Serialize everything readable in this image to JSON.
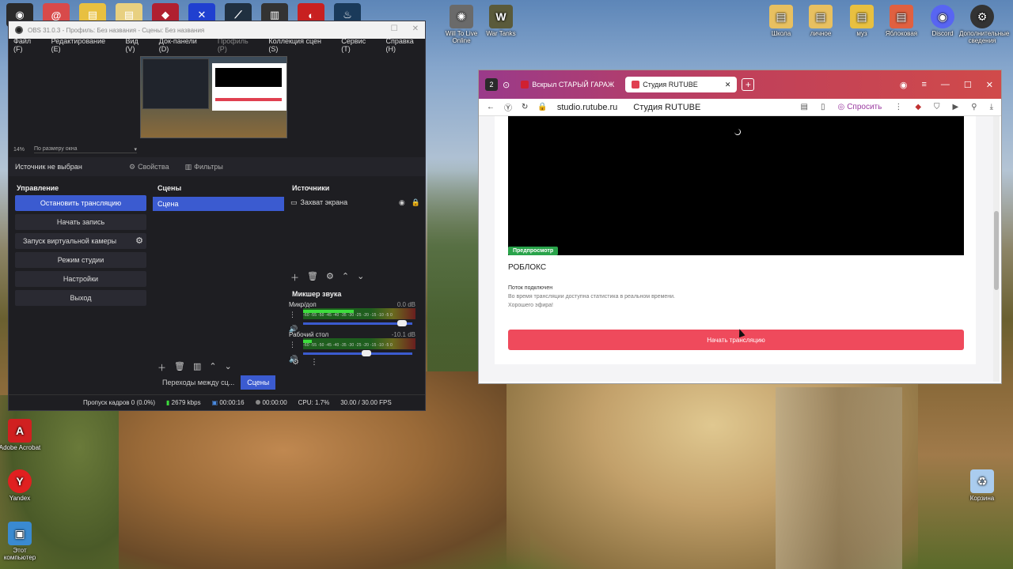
{
  "desktop": {
    "top_icons": [
      {
        "label": "",
        "color": "#2a2a2a",
        "icon": "camera-icon"
      },
      {
        "label": "",
        "color": "#d84a4a",
        "icon": "spiral-icon"
      },
      {
        "label": "",
        "color": "#e8c040",
        "icon": "folder-icon"
      },
      {
        "label": "",
        "color": "#e8d080",
        "icon": "folder-icon"
      },
      {
        "label": "",
        "color": "#b02030",
        "icon": "game-icon"
      },
      {
        "label": "",
        "color": "#2040d0",
        "icon": "playstation-icon"
      },
      {
        "label": "",
        "color": "#203040",
        "icon": "game-icon"
      },
      {
        "label": "",
        "color": "#333333",
        "icon": "armor-icon"
      },
      {
        "label": "",
        "color": "#c82020",
        "icon": "circle-icon"
      },
      {
        "label": "",
        "color": "#1a3a5a",
        "icon": "steam-icon"
      }
    ],
    "icons": [
      {
        "label": "Will To Live Online",
        "symbol": "✺",
        "color": "#6a6a6a"
      },
      {
        "label": "War Tanks",
        "symbol": "W",
        "color": "#5a5a3a"
      },
      {
        "label": "Школа",
        "symbol": "▤",
        "color": "#e8c060"
      },
      {
        "label": "личное",
        "symbol": "▤",
        "color": "#e8c060"
      },
      {
        "label": "муз",
        "symbol": "▤",
        "color": "#e8c040"
      },
      {
        "label": "Яблоковая",
        "symbol": "▤",
        "color": "#e06040"
      },
      {
        "label": "Discord",
        "symbol": "◉",
        "color": "#5865f2"
      },
      {
        "label": "Дополнительные сведения",
        "symbol": "⚙",
        "color": "#333333"
      },
      {
        "label": "Adobe Acrobat",
        "symbol": "A",
        "color": "#d02020"
      },
      {
        "label": "Yandex",
        "symbol": "Y",
        "color": "#e02020"
      },
      {
        "label": "Этот компьютер",
        "symbol": "▣",
        "color": "#3a8ad0"
      },
      {
        "label": "Корзина",
        "symbol": "♻",
        "color": "#aaccee"
      }
    ]
  },
  "obs": {
    "title": "OBS 31.0.3 - Профиль: Без названия - Сцены: Без названия",
    "menu": [
      "Файл (F)",
      "Редактирование (E)",
      "Вид (V)",
      "Док-панели (D)",
      "Профиль (P)",
      "Коллекция сцен (S)",
      "Сервис (T)",
      "Справка (H)"
    ],
    "zoom": {
      "percent": "14%",
      "mode": "По размеру окна"
    },
    "source_bar": {
      "no_source": "Источник не выбран",
      "properties": "Свойства",
      "filters": "Фильтры"
    },
    "controls": {
      "title": "Управление",
      "stop_stream": "Остановить трансляцию",
      "start_record": "Начать запись",
      "virtual_cam": "Запуск виртуальной камеры",
      "studio_mode": "Режим студии",
      "settings": "Настройки",
      "exit": "Выход"
    },
    "scenes": {
      "title": "Сцены",
      "items": [
        "Сцена"
      ],
      "tab_transitions": "Переходы между сц...",
      "tab_scenes": "Сцены"
    },
    "sources": {
      "title": "Источники",
      "items": [
        "Захват экрана"
      ]
    },
    "mixer": {
      "title": "Микшер звука",
      "channels": [
        {
          "name": "Микр/доп",
          "db": "0.0 dB",
          "level": 0.45,
          "volume": 0.95
        },
        {
          "name": "Рабочий стол",
          "db": "-10.1 dB",
          "level": 0.08,
          "volume": 0.62
        }
      ],
      "scale": "-60 -55 -50 -45 -40 -35 -30 -25 -20 -15 -10 -5 0"
    },
    "status": {
      "dropped": "Пропуск кадров 0 (0.0%)",
      "bitrate": "2679 kbps",
      "stream_time": "00:00:16",
      "rec_time": "00:00:00",
      "cpu": "CPU: 1.7%",
      "fps": "30.00 / 30.00 FPS"
    }
  },
  "browser": {
    "workspace": "2",
    "tabs": [
      {
        "title": "Вскрыл СТАРЫЙ ГАРАЖ",
        "active": false
      },
      {
        "title": "Студия RUTUBE",
        "active": true
      }
    ],
    "url": "studio.rutube.ru",
    "site_title": "Студия RUTUBE",
    "ask_label": "Спросить",
    "page": {
      "preview_badge": "Предпросмотр",
      "stream_title": "РОБЛОКС",
      "connected": "Поток подключен",
      "desc": "Во время трансляции доступна статистика в реальном времени.",
      "wish": "Хорошего эфира!",
      "start_button": "Начать трансляцию"
    }
  }
}
